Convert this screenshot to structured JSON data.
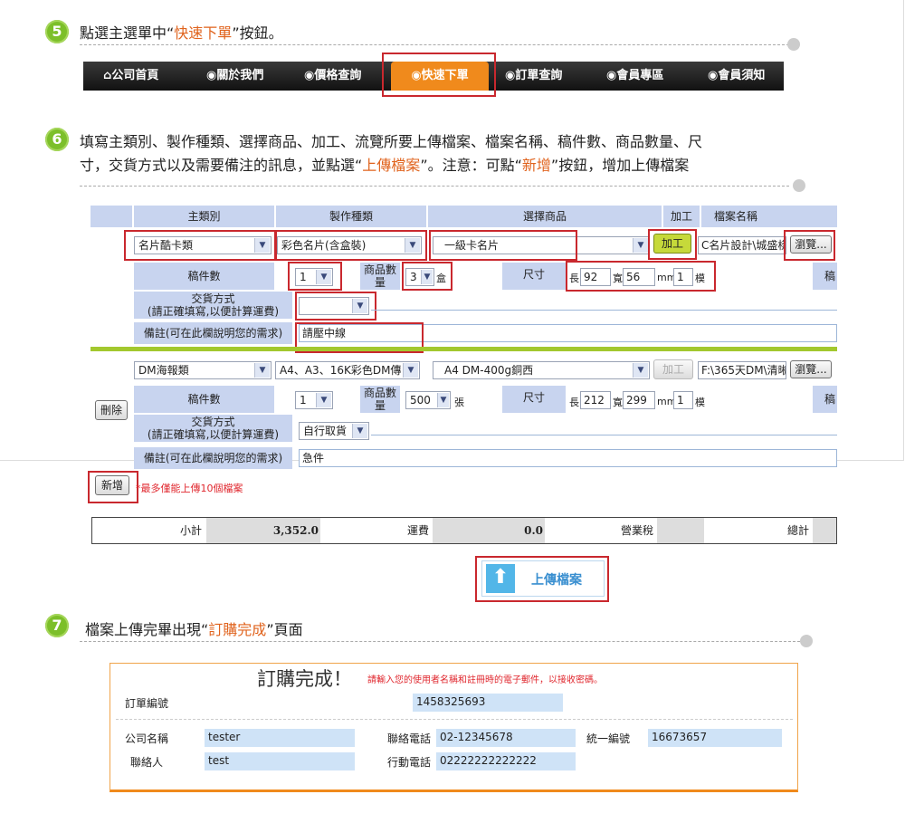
{
  "step5": {
    "num": "5",
    "pre": "點選主選單中“",
    "hl": "快速下單",
    "post": "”按鈕。"
  },
  "nav": {
    "items": [
      "公司首頁",
      "關於我們",
      "價格查詢",
      "快速下單",
      "訂單查詢",
      "會員專區",
      "會員須知"
    ]
  },
  "step6": {
    "num": "6",
    "line1": "填寫主類別、製作種類、選擇商品、加工、流覽所要上傳檔案、檔案名稱、稿件數、商品數量、尺",
    "line2_pre": "寸，交貨方式以及需要備注的訊息，並點選“",
    "line2_hl1": "上傳檔案",
    "line2_mid": "”。注意：可點“",
    "line2_hl2": "新增",
    "line2_post": "”按鈕，增加上傳檔案"
  },
  "form": {
    "headers": {
      "main": "主類別",
      "kind": "製作種類",
      "product": "選擇商品",
      "process": "加工",
      "filename": "檔案名稱"
    },
    "row1": {
      "main": "名片酷卡類",
      "kind": "彩色名片(含盒裝)",
      "product": "一級卡名片",
      "process_btn": "加工",
      "filename": "C名片設計\\城盛樣",
      "browse": "瀏覽...",
      "drafts_label": "稿件數",
      "drafts": "1",
      "qty_label": "商品數量",
      "qty": "3",
      "qty_unit": "盒",
      "size_label": "尺寸",
      "len_label": "長",
      "len": "92",
      "wid_label": "寬",
      "wid": "56",
      "mm": "mm",
      "mold": "1",
      "mold_label": "模",
      "trunc": "稿",
      "delivery_label": "交貨方式",
      "delivery_note": "(請正確填寫,以便計算運費)",
      "delivery": "",
      "remark_label": "備註(可在此欄說明您的需求)",
      "remark": "請壓中線"
    },
    "row2": {
      "main": "DM海報類",
      "kind": "A4、A3、16K彩色DM傳",
      "product": "A4 DM-400g銅西",
      "process_btn": "加工",
      "filename": "F:\\365天DM\\清晰",
      "browse": "瀏覽...",
      "delete": "刪除",
      "drafts_label": "稿件數",
      "drafts": "1",
      "qty_label": "商品數量",
      "qty": "500",
      "qty_unit": "張",
      "size_label": "尺寸",
      "len_label": "長",
      "len": "212",
      "wid_label": "寬",
      "wid": "299",
      "mm": "mm",
      "mold": "1",
      "mold_label": "模",
      "trunc": "稿",
      "delivery_label": "交貨方式",
      "delivery_note": "(請正確填寫,以便計算運費)",
      "delivery": "自行取貨",
      "remark_label": "備註(可在此欄說明您的需求)",
      "remark": "急件"
    },
    "add_btn": "新增",
    "add_note": "*最多僅能上傳10個檔案",
    "summary": {
      "subtotal_label": "小計",
      "subtotal": "3,352.0",
      "shipping_label": "運費",
      "shipping": "0.0",
      "tax_label": "營業稅",
      "total_label": "總計"
    },
    "upload_btn": "上傳檔案"
  },
  "step7": {
    "num": "7",
    "pre": "檔案上傳完畢出現“",
    "hl": "訂購完成",
    "post": "”頁面"
  },
  "order": {
    "title": "訂購完成！",
    "notice": "請輸入您的使用者名稱和註冊時的電子郵件，以接收密碼。",
    "order_no_label": "訂單編號",
    "order_no": "1458325693",
    "company_label": "公司名稱",
    "company": "tester",
    "phone_label": "聯絡電話",
    "phone": "02-12345678",
    "taxid_label": "統一編號",
    "taxid": "16673657",
    "contact_label": "聯絡人",
    "contact": "test",
    "mobile_label": "行動電話",
    "mobile": "02222222222222"
  },
  "colors": {
    "accent": "#e0631d",
    "highlight_box": "#c9282e",
    "header_bg": "#c8d4ef",
    "nav_active": "#f08a1c",
    "step_badge": "#7cbf2a"
  }
}
